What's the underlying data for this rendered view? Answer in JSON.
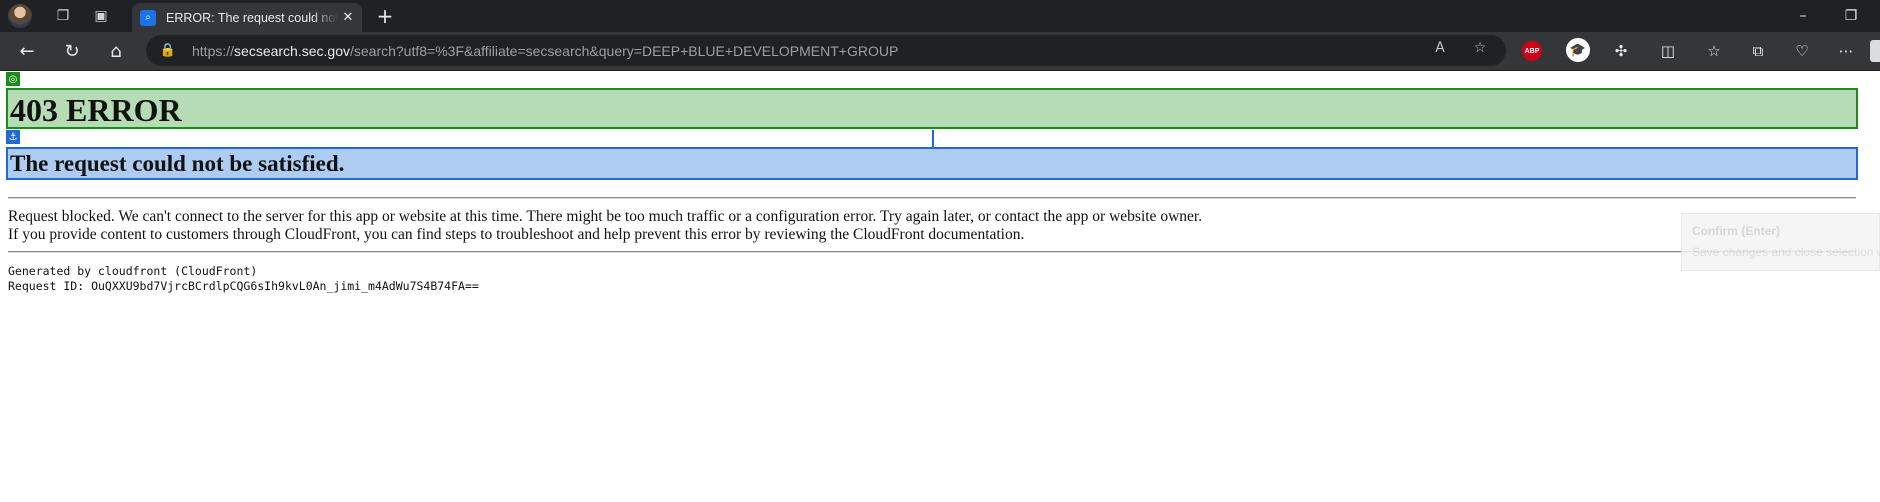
{
  "browser": {
    "tab": {
      "title": "ERROR: The request could not be satisfied",
      "favicon": "search-icon"
    },
    "address": {
      "scheme": "https://",
      "host": "secsearch.sec.gov",
      "path": "/search?utf8=%3F&affiliate=secsearch&query=DEEP+BLUE+DEVELOPMENT+GROUP"
    },
    "extensions": {
      "abp_label": "ABP"
    },
    "icons": {
      "profile": "profile-avatar-icon",
      "workspaces": "workspaces-icon",
      "tab_actions": "tab-actions-icon",
      "new_tab": "plus-icon",
      "back": "back-arrow-icon",
      "refresh": "refresh-icon",
      "home": "home-icon",
      "lock": "lock-icon",
      "read_aloud": "read-aloud-icon",
      "favorite": "star-icon",
      "extensions": "puzzle-icon",
      "split": "split-screen-icon",
      "favorites": "favorites-icon",
      "collections": "collections-icon",
      "health": "browser-essentials-icon",
      "more": "more-icon",
      "minimize": "minimize-icon",
      "restore": "restore-icon"
    }
  },
  "page": {
    "heading": "403 ERROR",
    "subheading": "The request could not be satisfied.",
    "paragraph1": "Request blocked. We can't connect to the server for this app or website at this time. There might be too much traffic or a configuration error. Try again later, or contact the app or website owner.",
    "paragraph2": "If you provide content to customers through CloudFront, you can find steps to troubleshoot and help prevent this error by reviewing the CloudFront documentation.",
    "generated_by": "Generated by cloudfront (CloudFront)",
    "request_id": "Request ID: OuQXXU9bd7VjrcBCrdlpCQG6sIh9kvL0An_jimi_m4AdWu7S4B74FA=="
  },
  "overlay": {
    "tooltip_title": "Confirm (Enter)",
    "tooltip_body": "Save changes and close selection w"
  },
  "colors": {
    "heading_bg": "#b5dcb5",
    "heading_border": "#1a8c1a",
    "subheading_bg": "#aecbf2",
    "subheading_border": "#1f6bd1"
  }
}
